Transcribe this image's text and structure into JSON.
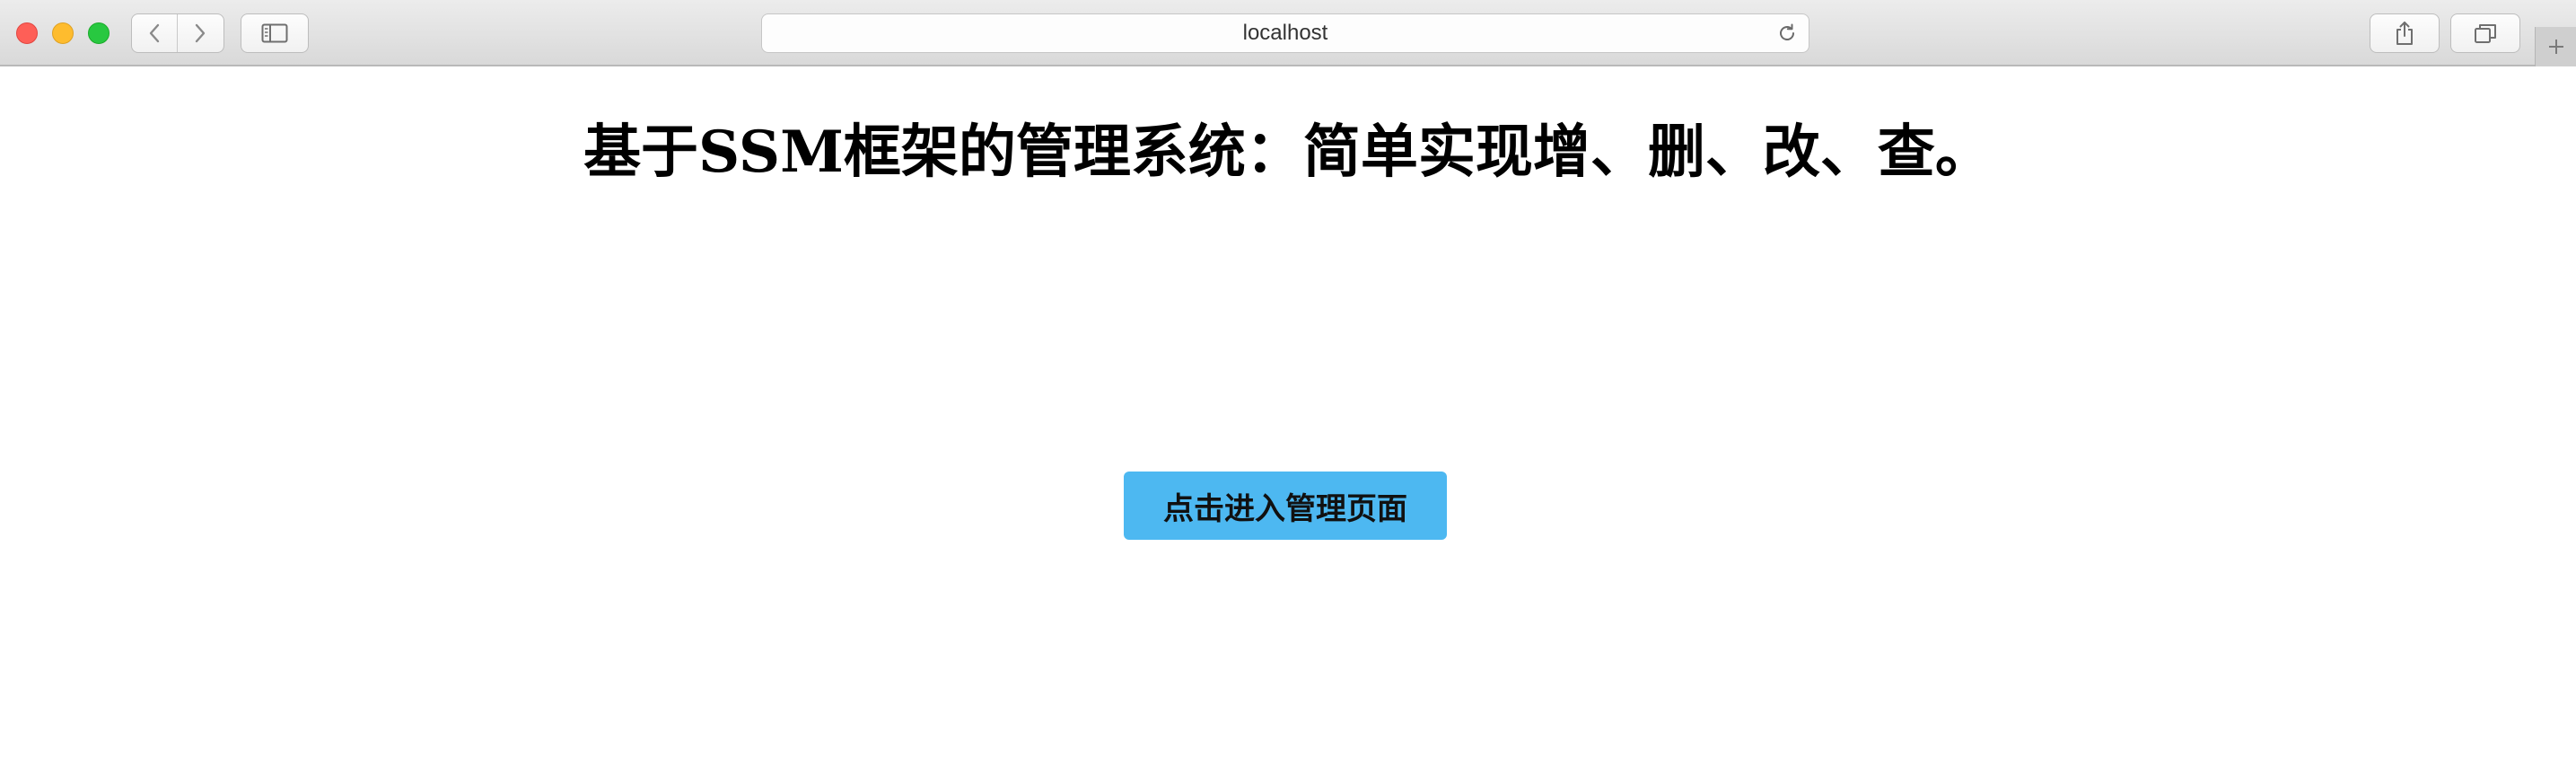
{
  "browser": {
    "address": "localhost",
    "icons": {
      "back": "chevron-left-icon",
      "forward": "chevron-right-icon",
      "sidebar": "sidebar-icon",
      "reload": "reload-icon",
      "share": "share-icon",
      "tabs": "tabs-overview-icon",
      "new_tab": "plus-icon"
    },
    "colors": {
      "close": "#fe5f57",
      "minimize": "#febc2e",
      "zoom": "#28c840"
    }
  },
  "page": {
    "title": "基于SSM框架的管理系统：简单实现增、删、改、查。",
    "enter_button_label": "点击进入管理页面",
    "accent_color": "#4db8f1"
  }
}
